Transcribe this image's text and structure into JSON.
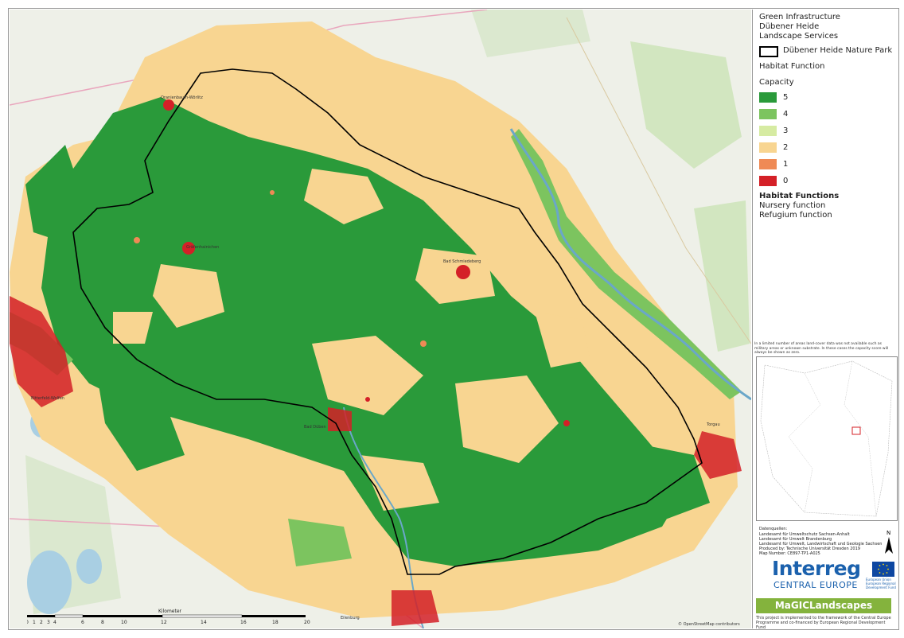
{
  "legend": {
    "title_lines": [
      "Green Infrastructure",
      "Dübener Heide",
      "Landscape Services"
    ],
    "boundary_label": "Dübener Heide Nature Park",
    "function_label": "Habitat Function",
    "capacity_label": "Capacity",
    "capacity_items": [
      {
        "label": "5",
        "color": "#2a9a3a"
      },
      {
        "label": "4",
        "color": "#7cc45f"
      },
      {
        "label": "3",
        "color": "#d6eba2"
      },
      {
        "label": "2",
        "color": "#f8d591"
      },
      {
        "label": "1",
        "color": "#ef8a55"
      },
      {
        "label": "0",
        "color": "#d42027"
      }
    ],
    "functions_heading": "Habitat Functions",
    "functions": [
      "Nursery function",
      "Refugium function"
    ],
    "note": "In a limited number of areas land-cover data was not available such as military areas or unknown substrate. In these cases the capacity score will always be shown as zero."
  },
  "sources": {
    "heading": "Datenquellen:",
    "lines": [
      "Landesamt für Umweltschutz Sachsen-Anhalt",
      "Landesamt für Umwelt Brandenburg",
      "Landesamt für Umwelt, Landwirtschaft und Geologie Sachsen",
      "Produced by: Technische Universität Dresden 2019",
      "Map Number: CE897-TP1-A025"
    ]
  },
  "north_label": "N",
  "branding": {
    "program": "Interreg",
    "region": "CENTRAL EUROPE",
    "eu_text": "European Union European Regional Development Fund",
    "project": "MaGICLandscapes",
    "footer": "This project is implemented to the framework of the Central Europe Programme and co-financed by European Regional Development Fund"
  },
  "scale": {
    "unit": "Kilometer",
    "ticks": [
      "0",
      "1",
      "2",
      "3",
      "4",
      "6",
      "8",
      "10",
      "12",
      "14",
      "16",
      "18",
      "20"
    ]
  },
  "places": [
    {
      "name": "Gräfenhainichen"
    },
    {
      "name": "Bad Schmiedeberg"
    },
    {
      "name": "Oranienbaum-Wörlitz"
    },
    {
      "name": "Bitterfeld-Wolfen"
    },
    {
      "name": "Bad Düben"
    },
    {
      "name": "Torgau"
    },
    {
      "name": "Eilenburg"
    }
  ],
  "attribution": "© OpenStreetMap contributors",
  "colors": {
    "boundary": "#000000",
    "river": "#6aa7c9",
    "base": "#eef0e8"
  }
}
